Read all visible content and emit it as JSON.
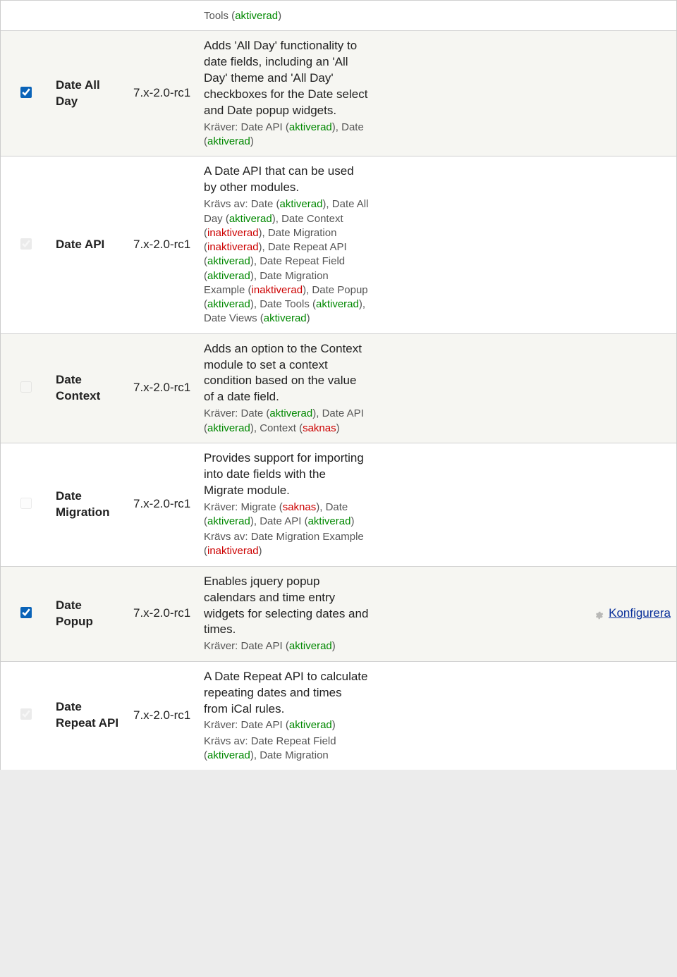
{
  "statuses": {
    "aktiverad": "aktiverad",
    "inaktiverad": "inaktiverad",
    "saknas": "saknas"
  },
  "labels": {
    "requires": "Kräver:",
    "required_by": "Krävs av:",
    "configure": "Konfigurera"
  },
  "rows": [
    {
      "id": "date-cutoff",
      "cutoff": true,
      "desc_tail": "Tools (",
      "deps_tail": [
        "aktiverad",
        ")"
      ]
    },
    {
      "id": "date-all-day",
      "name": "Date All Day",
      "version": "7.x-2.0-rc1",
      "checked": true,
      "disabled": false,
      "description": "Adds 'All Day' functionality to date fields, including an 'All Day' theme and 'All Day' checkboxes for the Date select and Date popup widgets.",
      "requires": [
        {
          "name": "Date API",
          "status": "aktiverad"
        },
        {
          "name": "Date",
          "status": "aktiverad"
        }
      ]
    },
    {
      "id": "date-api",
      "name": "Date API",
      "version": "7.x-2.0-rc1",
      "checked": true,
      "disabled": true,
      "description": "A Date API that can be used by other modules.",
      "required_by": [
        {
          "name": "Date",
          "status": "aktiverad"
        },
        {
          "name": "Date All Day",
          "status": "aktiverad"
        },
        {
          "name": "Date Context",
          "status": "inaktiverad"
        },
        {
          "name": "Date Migration",
          "status": "inaktiverad"
        },
        {
          "name": "Date Repeat API",
          "status": "aktiverad"
        },
        {
          "name": "Date Repeat Field",
          "status": "aktiverad"
        },
        {
          "name": "Date Migration Example",
          "status": "inaktiverad"
        },
        {
          "name": "Date Popup",
          "status": "aktiverad"
        },
        {
          "name": "Date Tools",
          "status": "aktiverad"
        },
        {
          "name": "Date Views",
          "status": "aktiverad"
        }
      ]
    },
    {
      "id": "date-context",
      "name": "Date Context",
      "version": "7.x-2.0-rc1",
      "checked": false,
      "disabled": true,
      "description": "Adds an option to the Context module to set a context condition based on the value of a date field.",
      "requires": [
        {
          "name": "Date",
          "status": "aktiverad"
        },
        {
          "name": "Date API",
          "status": "aktiverad"
        },
        {
          "name": "Context",
          "status": "saknas"
        }
      ]
    },
    {
      "id": "date-migration",
      "name": "Date Migration",
      "version": "7.x-2.0-rc1",
      "checked": false,
      "disabled": true,
      "description": "Provides support for importing into date fields with the Migrate module.",
      "requires": [
        {
          "name": "Migrate",
          "status": "saknas"
        },
        {
          "name": "Date",
          "status": "aktiverad"
        },
        {
          "name": "Date API",
          "status": "aktiverad"
        }
      ],
      "required_by": [
        {
          "name": "Date Migration Example",
          "status": "inaktiverad"
        }
      ]
    },
    {
      "id": "date-popup",
      "name": "Date Popup",
      "version": "7.x-2.0-rc1",
      "checked": true,
      "disabled": false,
      "description": "Enables jquery popup calendars and time entry widgets for selecting dates and times.",
      "requires": [
        {
          "name": "Date API",
          "status": "aktiverad"
        }
      ],
      "configure": true
    },
    {
      "id": "date-repeat-api",
      "name": "Date Repeat API",
      "version": "7.x-2.0-rc1",
      "checked": true,
      "disabled": true,
      "description": "A Date Repeat API to calculate repeating dates and times from iCal rules.",
      "requires": [
        {
          "name": "Date API",
          "status": "aktiverad"
        }
      ],
      "required_by": [
        {
          "name": "Date Repeat Field",
          "status": "aktiverad"
        },
        {
          "name": "Date Migration",
          "status_trailing": true
        }
      ],
      "trailing_cut": true
    }
  ]
}
